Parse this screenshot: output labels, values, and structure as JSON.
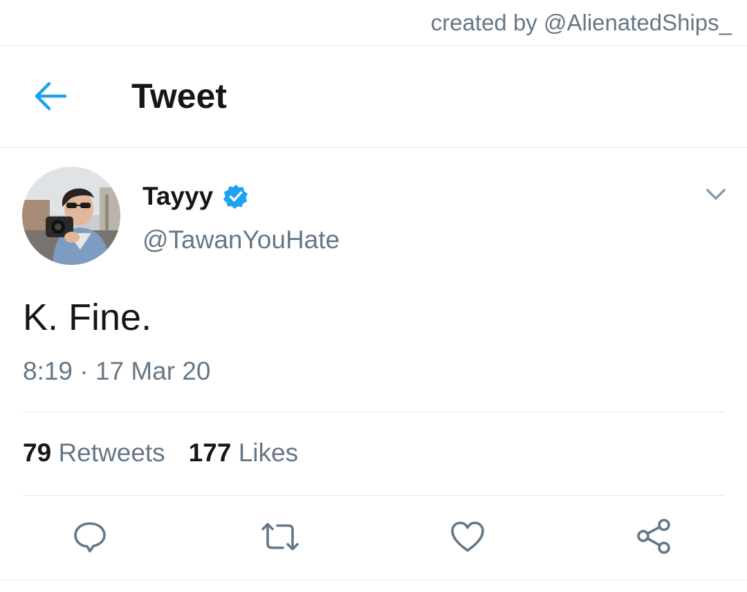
{
  "credit": {
    "text": "created by @AlienatedShips_"
  },
  "header": {
    "back_icon": "arrow-left-icon",
    "title": "Tweet"
  },
  "tweet": {
    "display_name": "Tayyy",
    "verified": true,
    "username": "@TawanYouHate",
    "text": "K. Fine.",
    "timestamp": "8:19 · 17 Mar 20"
  },
  "stats": {
    "retweets_count": "79",
    "retweets_label": "Retweets",
    "likes_count": "177",
    "likes_label": "Likes"
  },
  "actions": [
    {
      "icon": "reply-icon"
    },
    {
      "icon": "retweet-icon"
    },
    {
      "icon": "heart-icon"
    },
    {
      "icon": "share-icon"
    }
  ],
  "colors": {
    "accent": "#1da1f2",
    "text_primary": "#14171a",
    "text_secondary": "#657786",
    "divider": "#e1e8ed"
  }
}
